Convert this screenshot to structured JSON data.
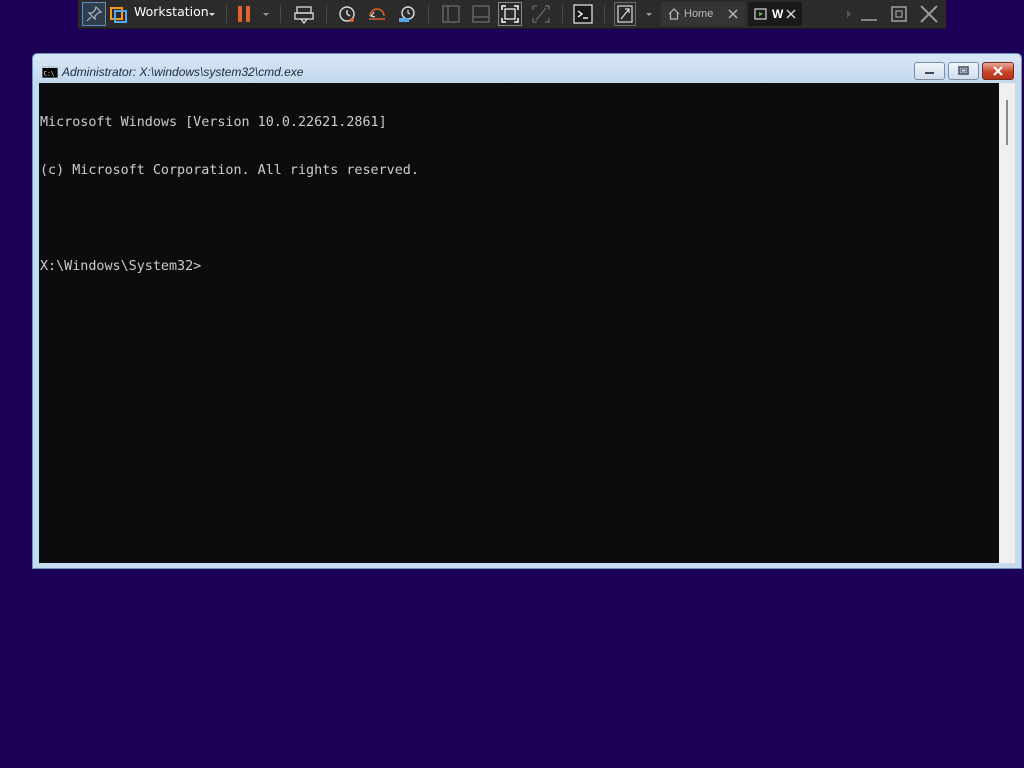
{
  "toolbar": {
    "product_label": "Workstation",
    "tabs": [
      {
        "label": "Home",
        "active": false
      },
      {
        "label": "W",
        "active": true
      }
    ],
    "icons": [
      "pin-icon",
      "vmware-logo-icon",
      "pause-icon",
      "print-icon",
      "snapshot-icon",
      "revert-snapshot-icon",
      "snapshot-manager-icon",
      "sidebar-icon",
      "thumbnail-icon",
      "full-screen-icon",
      "unity-icon",
      "console-icon",
      "stretch-icon",
      "home-icon",
      "close-tab-icon",
      "vm-tab-icon"
    ],
    "accent": "#e2642a"
  },
  "cmd": {
    "title": "Administrator: X:\\windows\\system32\\cmd.exe",
    "lines": [
      "Microsoft Windows [Version 10.0.22621.2861]",
      "(c) Microsoft Corporation. All rights reserved.",
      "",
      "X:\\Windows\\System32>"
    ],
    "console_bg": "#0c0c0c",
    "console_fg": "#cccccc"
  },
  "desktop": {
    "background": "#1c0057"
  }
}
